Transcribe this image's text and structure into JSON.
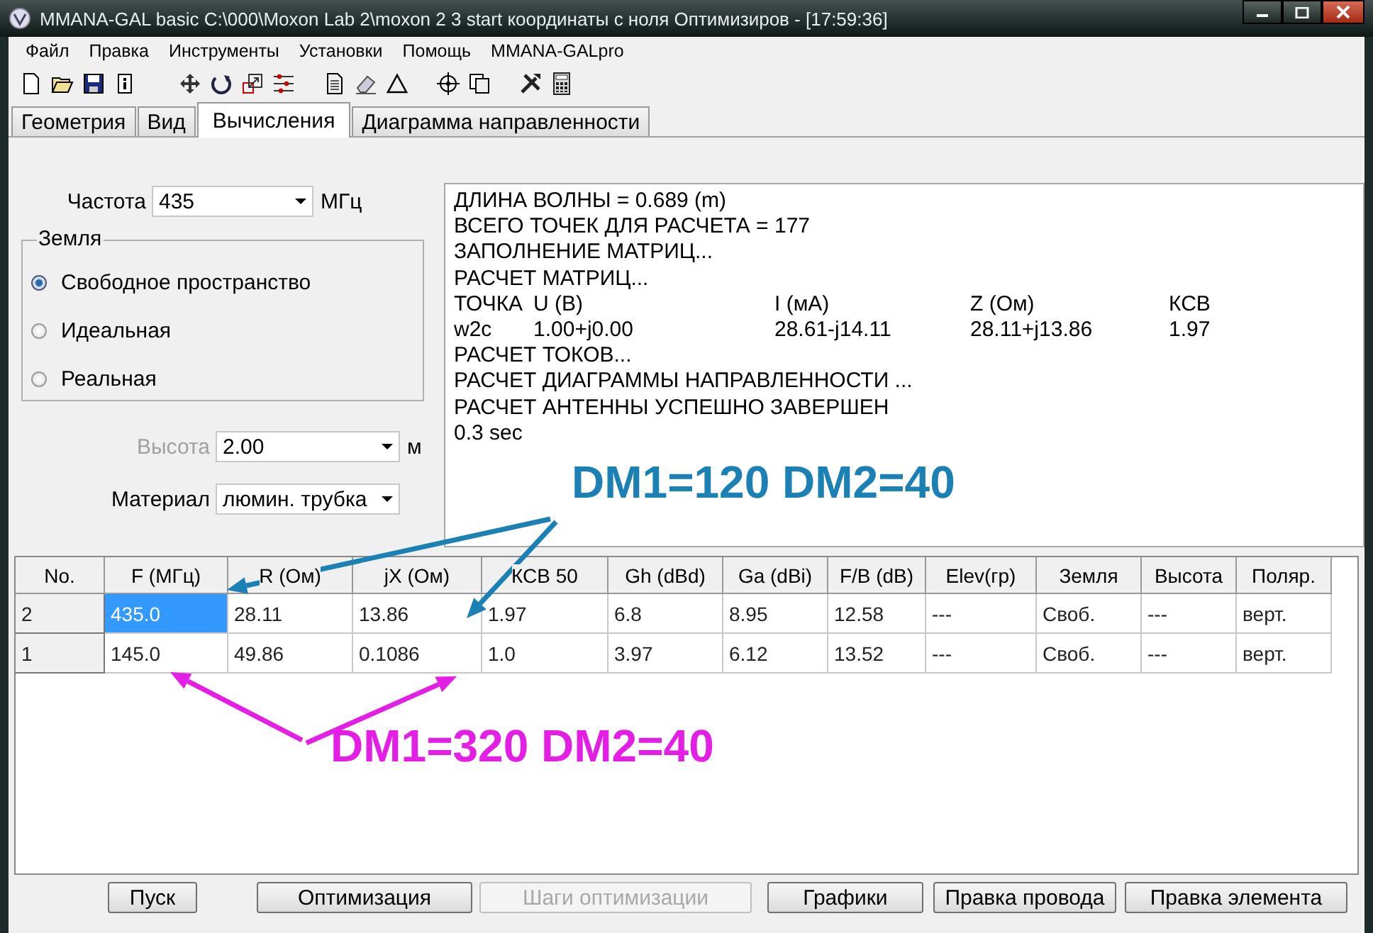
{
  "window": {
    "title": "MMANA-GAL basic C:\\000\\Moxon Lab 2\\moxon 2 3 start координаты с ноля Оптимизиров - [17:59:36]"
  },
  "menu": [
    "Файл",
    "Правка",
    "Инструменты",
    "Установки",
    "Помощь",
    "MMANA-GALpro"
  ],
  "tabs": [
    {
      "label": "Геометрия",
      "selected": false
    },
    {
      "label": "Вид",
      "selected": false
    },
    {
      "label": "Вычисления",
      "selected": true
    },
    {
      "label": "Диаграмма направленности",
      "selected": false
    }
  ],
  "frequency": {
    "label": "Частота",
    "value": "435",
    "unit": "МГц"
  },
  "ground": {
    "legend": "Земля",
    "options": [
      {
        "label": "Свободное пространство",
        "selected": true
      },
      {
        "label": "Идеальная",
        "selected": false
      },
      {
        "label": "Реальная",
        "selected": false
      }
    ]
  },
  "height": {
    "label": "Высота",
    "value": "2.00",
    "unit": "м",
    "disabled": true
  },
  "material": {
    "label": "Материал",
    "value": "люмин. трубка"
  },
  "output": [
    {
      "cells": [
        "ДЛИНА ВОЛНЫ = 0.689 (m)"
      ]
    },
    {
      "cells": [
        "ВСЕГО ТОЧЕК ДЛЯ РАСЧЕТА = 177"
      ]
    },
    {
      "cells": [
        "ЗАПОЛНЕНИЕ МАТРИЦ..."
      ]
    },
    {
      "cells": [
        "РАСЧЕТ МАТРИЦ..."
      ]
    },
    {
      "cells": [
        "ТОЧКА",
        "U (В)",
        "I (мА)",
        "Z (Ом)",
        "КСВ"
      ]
    },
    {
      "cells": [
        "w2c",
        "1.00+j0.00",
        "28.61-j14.11",
        "28.11+j13.86",
        "1.97"
      ]
    },
    {
      "cells": [
        "РАСЧЕТ ТОКОВ..."
      ]
    },
    {
      "cells": [
        "РАСЧЕТ ДИАГРАММЫ НАПРАВЛЕННОСТИ ..."
      ]
    },
    {
      "cells": [
        "РАСЧЕТ АНТЕННЫ УСПЕШНО ЗАВЕРШЕН"
      ]
    },
    {
      "cells": [
        "0.3 sec"
      ]
    }
  ],
  "table": {
    "columns": [
      "No.",
      "F (МГц)",
      "R (Ом)",
      "jX (Ом)",
      "КСВ 50",
      "Gh (dBd)",
      "Ga (dBi)",
      "F/B (dB)",
      "Elev(гр)",
      "Земля",
      "Высота",
      "Поляр."
    ],
    "rows": [
      {
        "cells": [
          {
            "text": "2",
            "selected": false
          },
          {
            "text": "435.0",
            "selected": true
          },
          {
            "text": "28.11",
            "selected": false
          },
          {
            "text": "13.86",
            "selected": false
          },
          {
            "text": "1.97",
            "selected": false
          },
          {
            "text": "6.8",
            "selected": false
          },
          {
            "text": "8.95",
            "selected": false
          },
          {
            "text": "12.58",
            "selected": false
          },
          {
            "text": "---",
            "selected": false
          },
          {
            "text": "Своб.",
            "selected": false
          },
          {
            "text": "---",
            "selected": false
          },
          {
            "text": "верт.",
            "selected": false
          }
        ]
      },
      {
        "cells": [
          {
            "text": "1",
            "selected": false
          },
          {
            "text": "145.0",
            "selected": false
          },
          {
            "text": "49.86",
            "selected": false
          },
          {
            "text": "0.1086",
            "selected": false
          },
          {
            "text": "1.0",
            "selected": false
          },
          {
            "text": "3.97",
            "selected": false
          },
          {
            "text": "6.12",
            "selected": false
          },
          {
            "text": "13.52",
            "selected": false
          },
          {
            "text": "---",
            "selected": false
          },
          {
            "text": "Своб.",
            "selected": false
          },
          {
            "text": "---",
            "selected": false
          },
          {
            "text": "верт.",
            "selected": false
          }
        ]
      }
    ]
  },
  "buttons": [
    {
      "label": "Пуск",
      "disabled": false
    },
    {
      "label": "Оптимизация",
      "disabled": false
    },
    {
      "label": "Шаги оптимизации",
      "disabled": true
    },
    {
      "label": "Графики",
      "disabled": false
    },
    {
      "label": "Правка провода",
      "disabled": false
    },
    {
      "label": "Правка элемента",
      "disabled": false
    }
  ],
  "annotations": [
    {
      "text": "DM1=120 DM2=40",
      "color": "#1b80b4"
    },
    {
      "text": "DM1=320 DM2=40",
      "color": "#e41ee4"
    }
  ]
}
